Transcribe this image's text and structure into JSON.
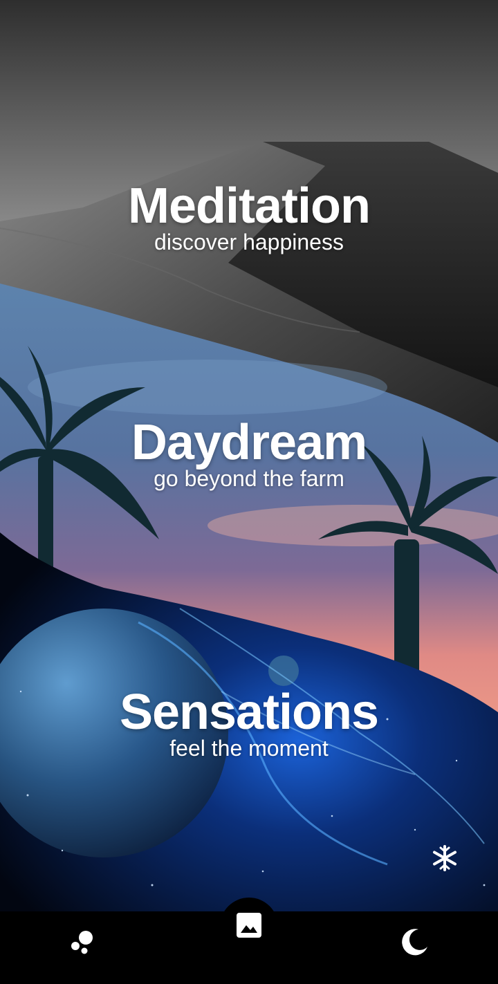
{
  "panels": [
    {
      "title": "Meditation",
      "subtitle": "discover happiness"
    },
    {
      "title": "Daydream",
      "subtitle": "go beyond the farm"
    },
    {
      "title": "Sensations",
      "subtitle": "feel the moment"
    }
  ],
  "icons": {
    "fab": "snowflake-icon",
    "nav": [
      "bubbles-icon",
      "image-icon",
      "moon-icon"
    ]
  },
  "colors": {
    "navbar": "#000000",
    "text": "#ffffff"
  }
}
